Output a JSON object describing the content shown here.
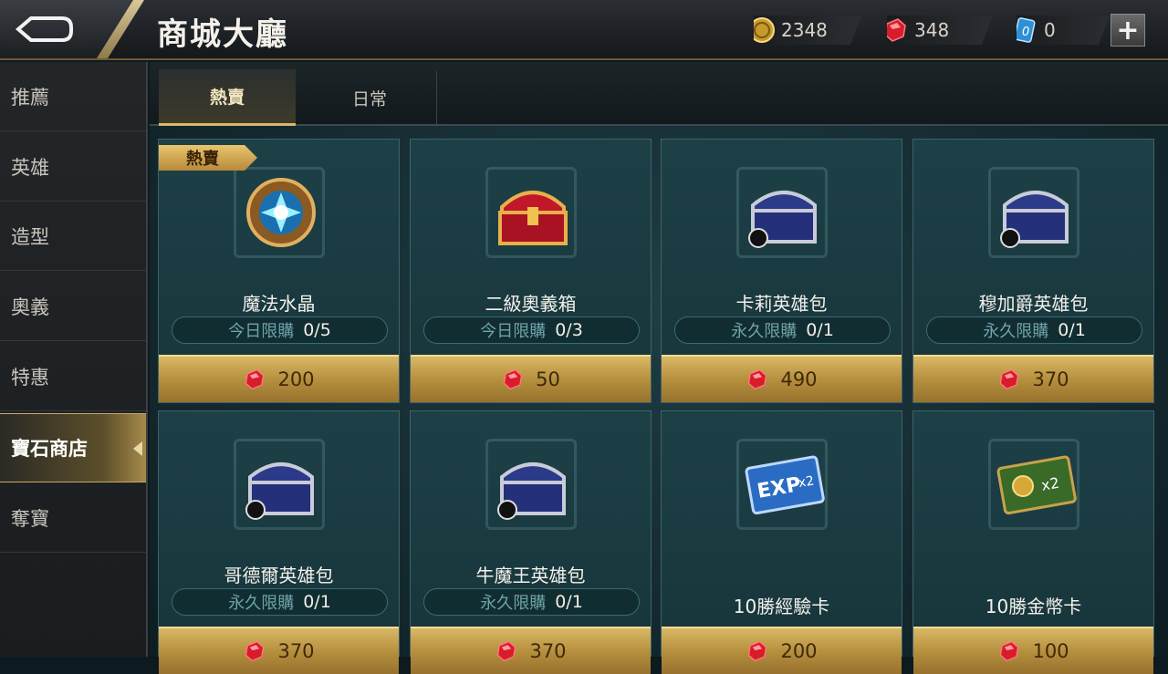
{
  "header": {
    "title": "商城大廳",
    "currencies": [
      {
        "icon": "gold-coin-icon",
        "value": "2348"
      },
      {
        "icon": "ruby-gem-icon",
        "value": "348"
      },
      {
        "icon": "voucher-card-icon",
        "value": "0"
      }
    ],
    "plus_label": "+"
  },
  "sidebar": {
    "items": [
      {
        "label": "推薦"
      },
      {
        "label": "英雄"
      },
      {
        "label": "造型"
      },
      {
        "label": "奧義"
      },
      {
        "label": "特惠"
      },
      {
        "label": "寶石商店",
        "active": true
      },
      {
        "label": "奪寶"
      }
    ]
  },
  "tabs": [
    {
      "label": "熱賣",
      "active": true
    },
    {
      "label": "日常"
    }
  ],
  "products": [
    {
      "name": "魔法水晶",
      "badge": "熱賣",
      "limit_text": "今日限購",
      "limit_count": "0/5",
      "price": "200",
      "icon": "magic-crystal-icon"
    },
    {
      "name": "二級奧義箱",
      "limit_text": "今日限購",
      "limit_count": "0/3",
      "price": "50",
      "icon": "red-chest-icon"
    },
    {
      "name": "卡莉英雄包",
      "limit_text": "永久限購",
      "limit_count": "0/1",
      "price": "490",
      "icon": "hero-chest-icon"
    },
    {
      "name": "穆加爵英雄包",
      "limit_text": "永久限購",
      "limit_count": "0/1",
      "price": "370",
      "icon": "hero-chest-icon"
    },
    {
      "name": "哥德爾英雄包",
      "limit_text": "永久限購",
      "limit_count": "0/1",
      "price": "370",
      "icon": "hero-chest-icon"
    },
    {
      "name": "牛魔王英雄包",
      "limit_text": "永久限購",
      "limit_count": "0/1",
      "price": "370",
      "icon": "hero-chest-icon"
    },
    {
      "name": "10勝經驗卡",
      "price": "200",
      "icon": "exp-card-icon",
      "card_text": "EXP",
      "card_mult": "x2"
    },
    {
      "name": "10勝金幣卡",
      "price": "100",
      "icon": "gold-card-icon",
      "card_mult": "x2"
    }
  ],
  "colors": {
    "gold_accent": "#d9b864",
    "panel_teal": "#1d4047",
    "ruby": "#e0202c"
  }
}
